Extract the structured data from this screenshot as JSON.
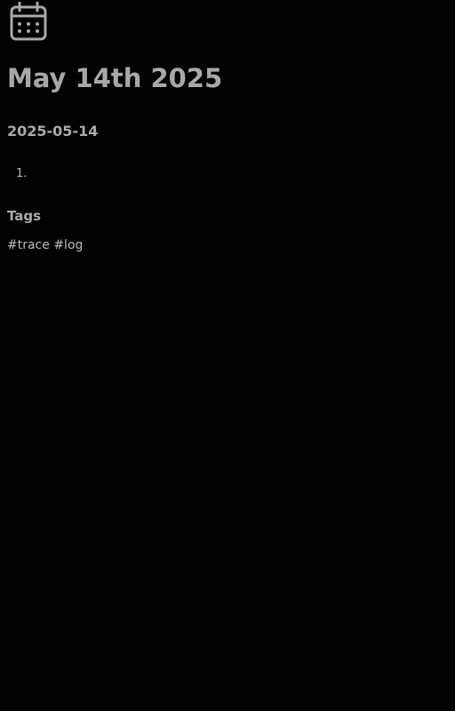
{
  "header": {
    "icon": "calendar-icon",
    "title": "May 14th 2025"
  },
  "content": {
    "date_heading": "2025-05-14",
    "list_items": [
      {
        "number": "1.",
        "text": ""
      }
    ]
  },
  "tags": {
    "heading": "Tags",
    "items": [
      "#trace",
      "#log"
    ]
  },
  "colors": {
    "background": "#000000",
    "text": "#a8a8a8"
  }
}
